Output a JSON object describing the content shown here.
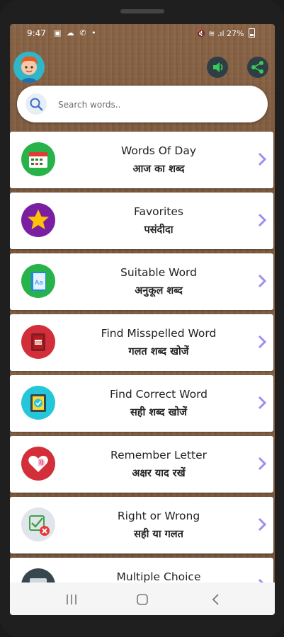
{
  "status_bar": {
    "time": "9:47",
    "left_icons": "▣ ☁ ✆ •",
    "right_icons": "🔇 ≋ .ıl",
    "battery": "27%"
  },
  "header": {
    "avatar_icon": "user-avatar-icon",
    "sound_icon": "speaker-icon",
    "share_icon": "share-icon"
  },
  "search": {
    "placeholder": "Search words.."
  },
  "menu": [
    {
      "title": "Words Of Day",
      "subtitle": "आज का शब्द",
      "icon": "calendar-icon"
    },
    {
      "title": "Favorites",
      "subtitle": "पसंदीदा",
      "icon": "star-icon"
    },
    {
      "title": "Suitable Word",
      "subtitle": "अनुकूल शब्द",
      "icon": "notebook-icon"
    },
    {
      "title": "Find Misspelled Word",
      "subtitle": "गलत शब्द खोजें",
      "icon": "error-book-icon"
    },
    {
      "title": "Find Correct Word",
      "subtitle": "सही शब्द खोजें",
      "icon": "check-book-icon"
    },
    {
      "title": "Remember Letter",
      "subtitle": "अक्षर याद रखें",
      "icon": "heart-brain-icon"
    },
    {
      "title": "Right or Wrong",
      "subtitle": "सही या गलत",
      "icon": "check-cross-icon"
    },
    {
      "title": "Multiple Choice",
      "subtitle": "",
      "icon": "keyboard-icon"
    }
  ],
  "colors": {
    "card_chevron": "#9d8ff0",
    "icon_bg_green": "#27b34a",
    "icon_bg_purple": "#7b1fa2",
    "icon_bg_red": "#d32f3a",
    "icon_bg_cyan": "#26c6da"
  }
}
